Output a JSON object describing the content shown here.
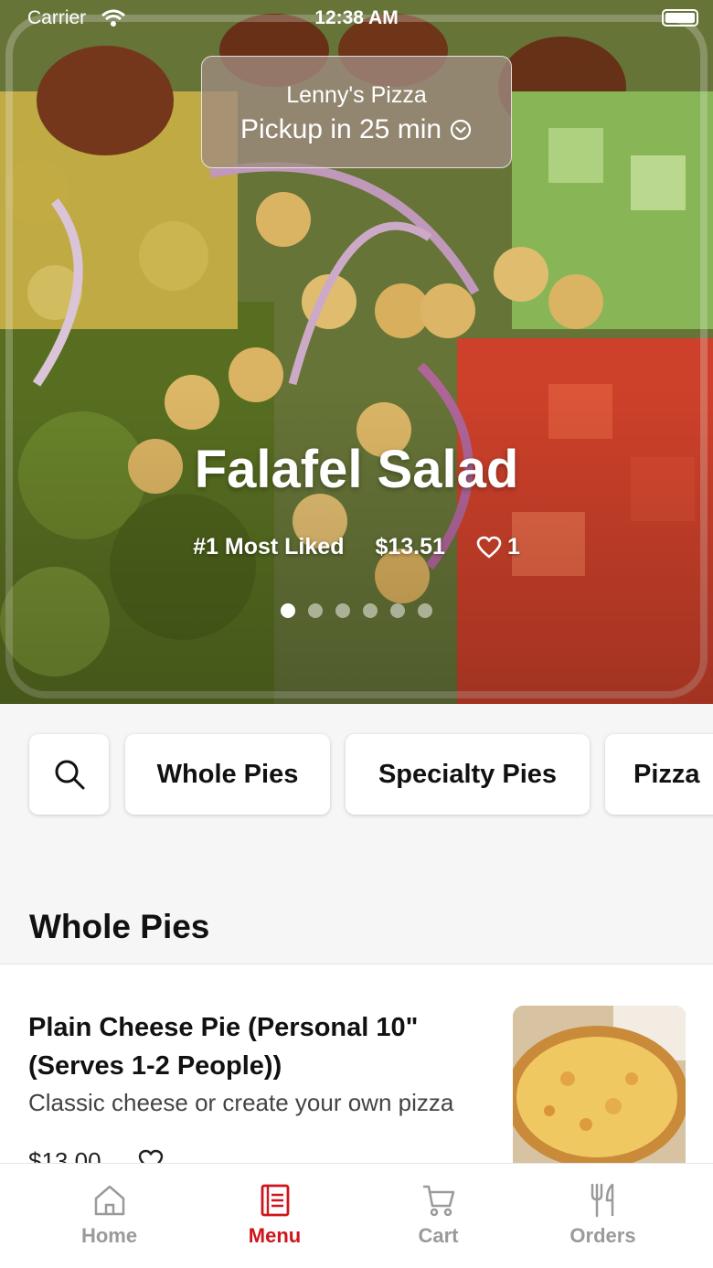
{
  "status_bar": {
    "carrier": "Carrier",
    "time": "12:38 AM"
  },
  "pickup": {
    "store_name": "Lenny's Pizza",
    "eta_label": "Pickup in 25 min"
  },
  "hero": {
    "dish_title": "Falafel Salad",
    "rank_label": "#1 Most Liked",
    "price": "$13.51",
    "like_count": "1",
    "slide_count": 6,
    "active_slide": 1
  },
  "categories": {
    "search_icon": "search-icon",
    "items": [
      "Whole Pies",
      "Specialty Pies",
      "Pizza"
    ]
  },
  "section": {
    "title": "Whole Pies"
  },
  "menu_items": [
    {
      "name": "Plain Cheese Pie (Personal 10\" (Serves 1-2 People))",
      "description": "Classic cheese or create your own pizza",
      "price": "$13.00"
    }
  ],
  "tabbar": {
    "accent_color": "#d0141c",
    "inactive_color": "#9a9a9a",
    "tabs": [
      {
        "label": "Home",
        "icon": "home-icon"
      },
      {
        "label": "Menu",
        "icon": "menu-icon"
      },
      {
        "label": "Cart",
        "icon": "cart-icon"
      },
      {
        "label": "Orders",
        "icon": "fork-knife-icon"
      }
    ],
    "active": "Menu"
  }
}
